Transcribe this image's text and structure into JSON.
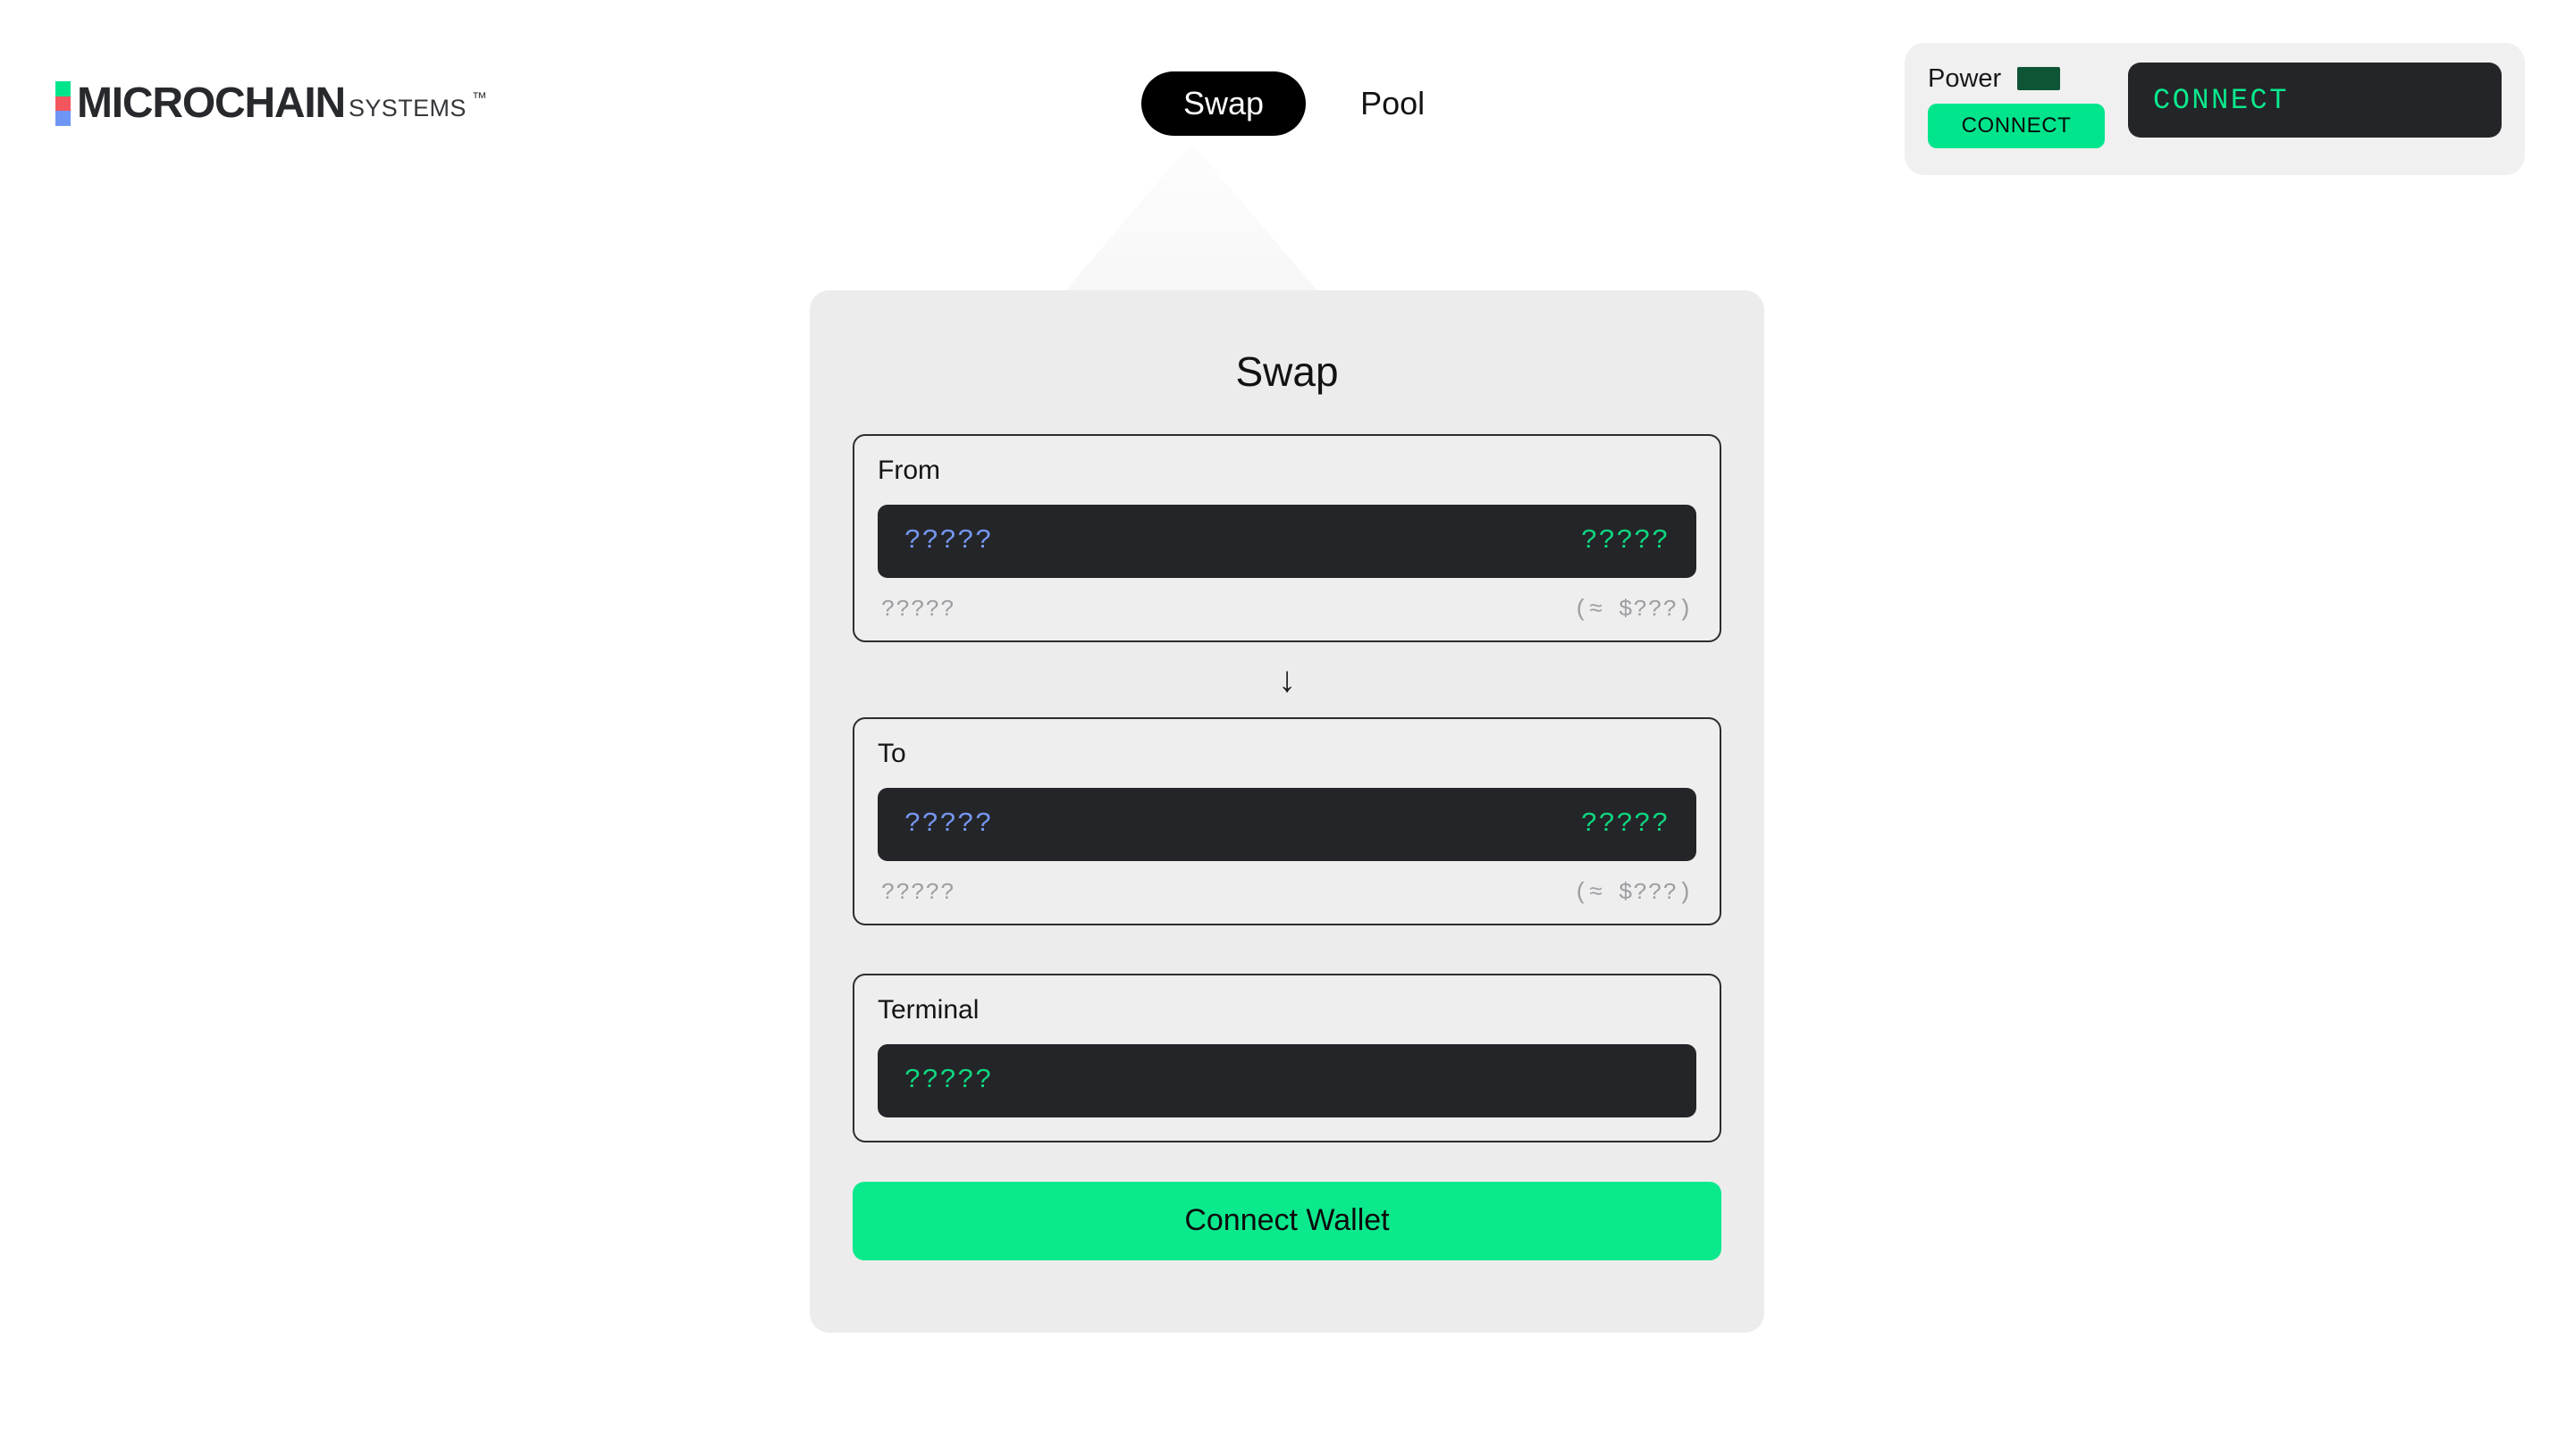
{
  "brand": {
    "word": "MICROCHAIN",
    "sub": "SYSTEMS",
    "tm": "™",
    "mark_colors": [
      "#00e58c",
      "#f4565f",
      "#6e96f5"
    ]
  },
  "nav": {
    "tabs": [
      {
        "label": "Swap",
        "active": true
      },
      {
        "label": "Pool",
        "active": false
      }
    ]
  },
  "widget": {
    "power_label": "Power",
    "indicator_color": "#0e5536",
    "connect_small_label": "CONNECT",
    "connect_big_label": "CONNECT",
    "accent": "#00e58c"
  },
  "card": {
    "title": "Swap",
    "from": {
      "label": "From",
      "token": "?????",
      "amount": "?????",
      "meta_left": "?????",
      "meta_right": "(≈ $???)"
    },
    "direction_arrow": "↓",
    "to": {
      "label": "To",
      "token": "?????",
      "amount": "?????",
      "meta_left": "?????",
      "meta_right": "(≈ $???)"
    },
    "terminal": {
      "label": "Terminal",
      "text": "?????"
    },
    "cta_label": "Connect Wallet",
    "cta_color": "#0be98d"
  }
}
